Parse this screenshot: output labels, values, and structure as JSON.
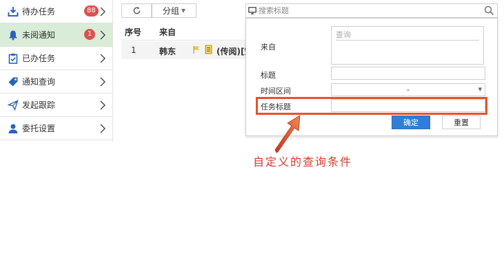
{
  "sidebar": {
    "items": [
      {
        "label": "待办任务",
        "badge": "88",
        "icon": "download-tray-icon",
        "active": false
      },
      {
        "label": "未阅通知",
        "badge": "1",
        "icon": "bell-icon",
        "active": true
      },
      {
        "label": "已办任务",
        "badge": "",
        "icon": "clipboard-check-icon",
        "active": false
      },
      {
        "label": "通知查询",
        "badge": "",
        "icon": "tag-icon",
        "active": false
      },
      {
        "label": "发起跟踪",
        "badge": "",
        "icon": "paper-plane-icon",
        "active": false
      },
      {
        "label": "委托设置",
        "badge": "",
        "icon": "user-icon",
        "active": false
      }
    ]
  },
  "toolbar": {
    "refresh_icon": "refresh-icon",
    "group_label": "分组"
  },
  "table": {
    "headers": [
      "序号",
      "来自"
    ],
    "rows": [
      {
        "index": "1",
        "from": "韩东",
        "title": "(传阅)[空"
      }
    ]
  },
  "search": {
    "placeholder": "搜索标题",
    "icon": "search-icon"
  },
  "panel": {
    "from_label": "来自",
    "query_placeholder": "查询",
    "title_label": "标题",
    "time_label": "时间区间",
    "time_value": "-",
    "task_title_label": "任务标题",
    "confirm_label": "确定",
    "reset_label": "重置"
  },
  "annotation": {
    "text": "自定义的查询条件"
  },
  "colors": {
    "active_bg": "#d8ecd8",
    "badge": "#d9534f",
    "primary": "#2f7fd6",
    "highlight": "#e0552a",
    "annotation": "#d83a2a"
  }
}
